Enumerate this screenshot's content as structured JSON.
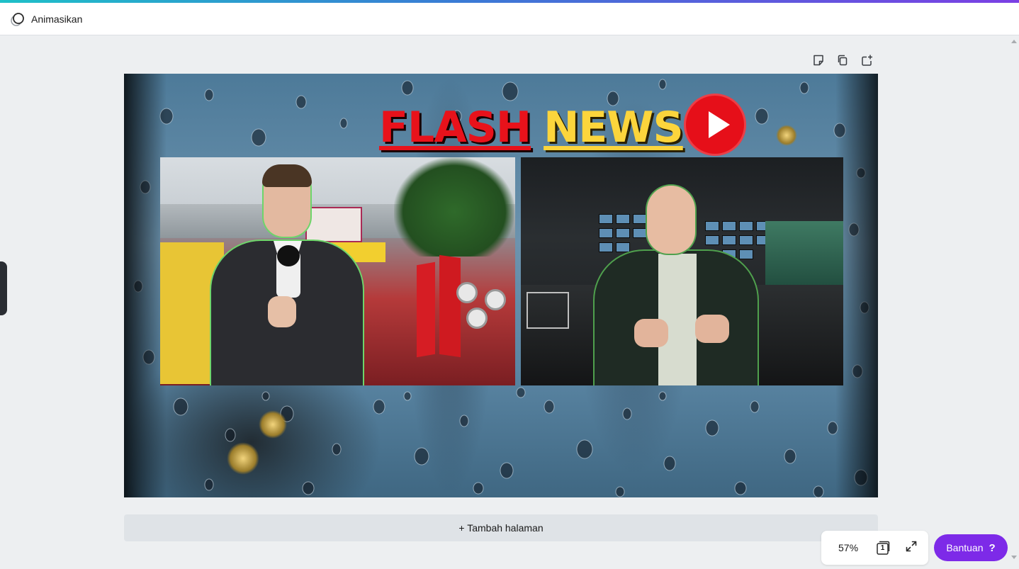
{
  "toolbar": {
    "animate_label": "Animasikan",
    "animate_icon": "animate-circles-icon"
  },
  "page_actions": [
    {
      "name": "add-note-button",
      "icon": "note-icon"
    },
    {
      "name": "duplicate-page-button",
      "icon": "duplicate-icon"
    },
    {
      "name": "add-page-button",
      "icon": "add-page-icon"
    }
  ],
  "canvas": {
    "headline_word_1": "FLASH",
    "headline_word_2": "NEWS",
    "headline_colors": {
      "flash": "#e8121b",
      "news": "#fcd53c",
      "play": "#e60f19"
    }
  },
  "add_page": {
    "label": "+ Tambah halaman"
  },
  "footer": {
    "zoom_value": "57%",
    "page_count": "1",
    "help_label": "Bantuan",
    "help_icon": "?"
  },
  "colors": {
    "accent_purple": "#7d2ae8",
    "workspace_bg": "#edeff1"
  }
}
